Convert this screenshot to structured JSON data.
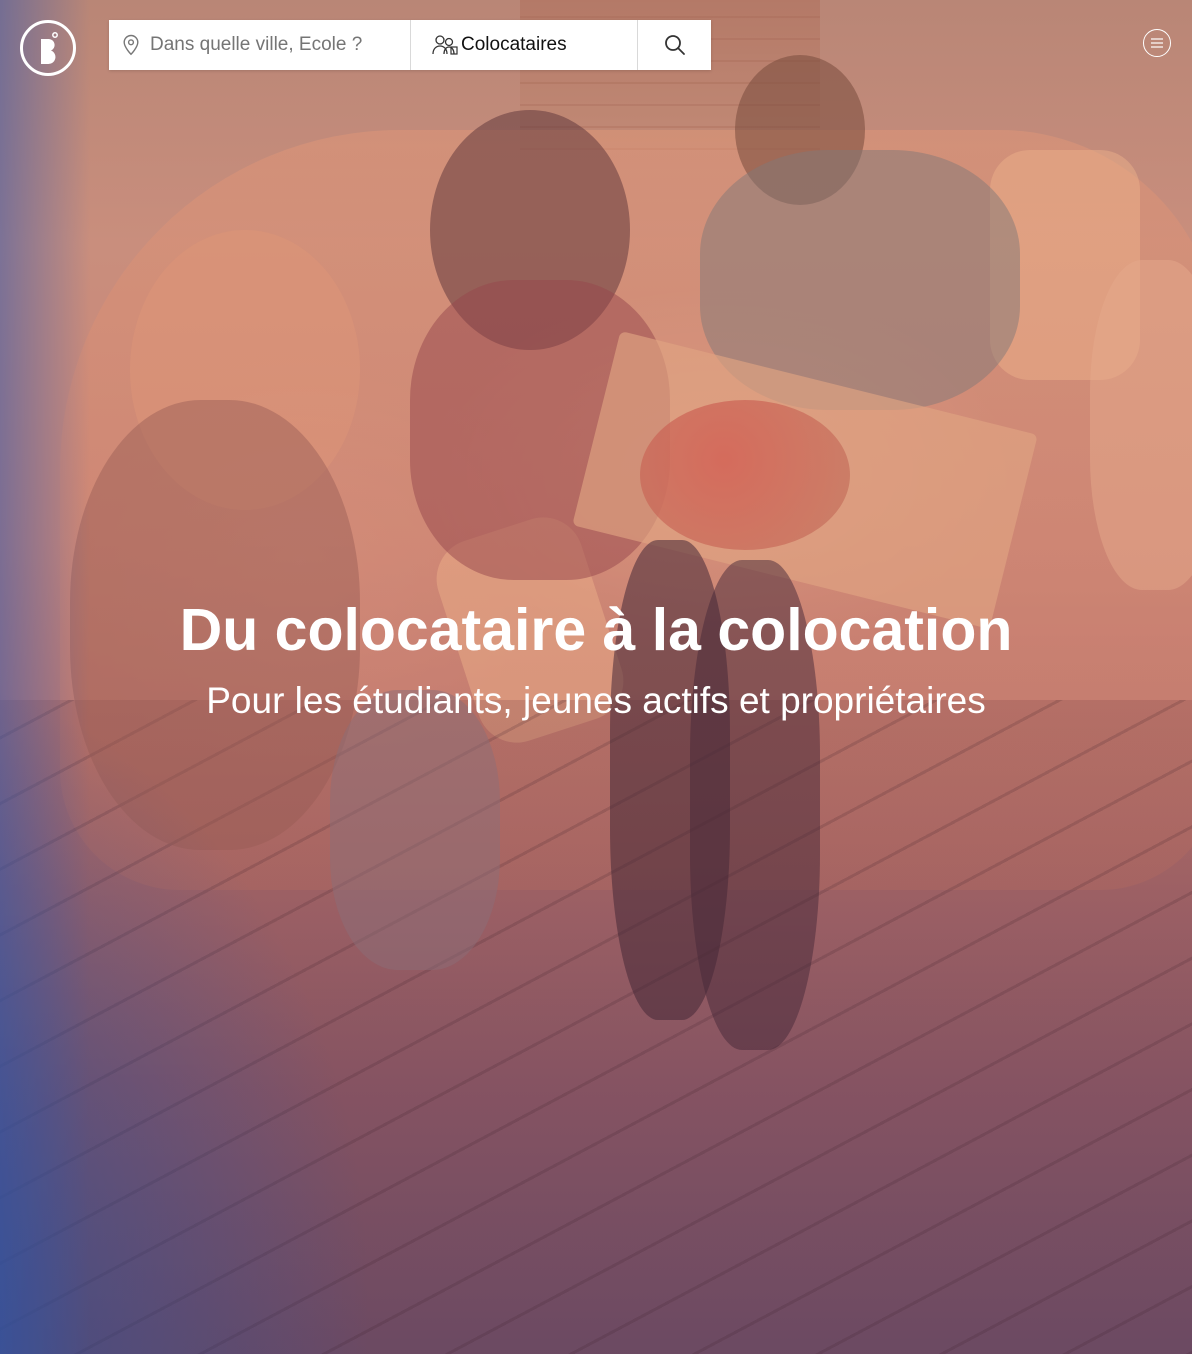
{
  "header": {
    "logo_icon": "bubble-logo-icon",
    "menu_icon": "hamburger-menu-icon"
  },
  "search": {
    "city_placeholder": "Dans quelle ville, Ecole ?",
    "city_icon": "location-pin-icon",
    "type_label": "Colocataires",
    "type_icon": "roommates-icon",
    "submit_icon": "search-icon"
  },
  "hero": {
    "title": "Du colocataire à la colocation",
    "subtitle": "Pour les étudiants, jeunes actifs et propriétaires"
  },
  "colors": {
    "overlay_warm": "#c98577",
    "overlay_blue": "#2850a0",
    "text": "#ffffff"
  }
}
